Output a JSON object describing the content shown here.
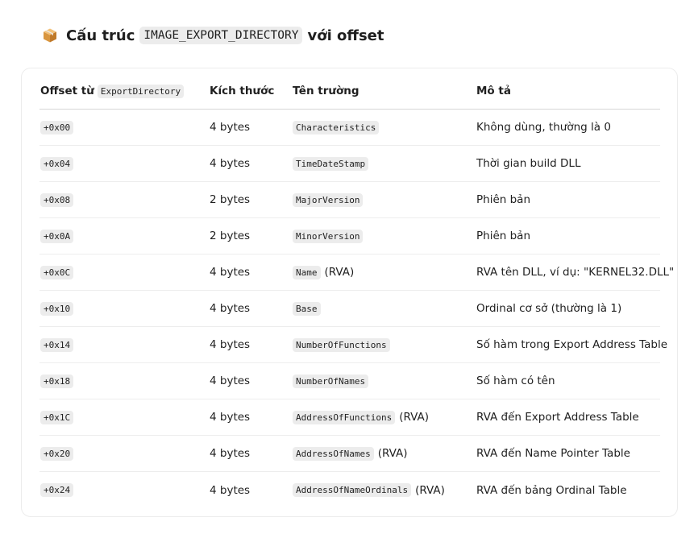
{
  "heading": {
    "prefix": "Cấu trúc",
    "code": "IMAGE_EXPORT_DIRECTORY",
    "suffix": "với offset"
  },
  "table": {
    "headers": {
      "offset_label": "Offset từ",
      "offset_code": "ExportDirectory",
      "size": "Kích thước",
      "field": "Tên trường",
      "description": "Mô tả"
    },
    "rows": [
      {
        "offset": "+0x00",
        "size": "4 bytes",
        "field": "Characteristics",
        "field_suffix": "",
        "description": "Không dùng, thường là 0"
      },
      {
        "offset": "+0x04",
        "size": "4 bytes",
        "field": "TimeDateStamp",
        "field_suffix": "",
        "description": "Thời gian build DLL"
      },
      {
        "offset": "+0x08",
        "size": "2 bytes",
        "field": "MajorVersion",
        "field_suffix": "",
        "description": "Phiên bản"
      },
      {
        "offset": "+0x0A",
        "size": "2 bytes",
        "field": "MinorVersion",
        "field_suffix": "",
        "description": "Phiên bản"
      },
      {
        "offset": "+0x0C",
        "size": "4 bytes",
        "field": "Name",
        "field_suffix": "(RVA)",
        "description": "RVA tên DLL, ví dụ: \"KERNEL32.DLL\""
      },
      {
        "offset": "+0x10",
        "size": "4 bytes",
        "field": "Base",
        "field_suffix": "",
        "description": "Ordinal cơ sở (thường là 1)"
      },
      {
        "offset": "+0x14",
        "size": "4 bytes",
        "field": "NumberOfFunctions",
        "field_suffix": "",
        "description": "Số hàm trong Export Address Table"
      },
      {
        "offset": "+0x18",
        "size": "4 bytes",
        "field": "NumberOfNames",
        "field_suffix": "",
        "description": "Số hàm có tên"
      },
      {
        "offset": "+0x1C",
        "size": "4 bytes",
        "field": "AddressOfFunctions",
        "field_suffix": "(RVA)",
        "description": "RVA đến Export Address Table"
      },
      {
        "offset": "+0x20",
        "size": "4 bytes",
        "field": "AddressOfNames",
        "field_suffix": "(RVA)",
        "description": "RVA đến Name Pointer Table"
      },
      {
        "offset": "+0x24",
        "size": "4 bytes",
        "field": "AddressOfNameOrdinals",
        "field_suffix": "(RVA)",
        "description": "RVA đến bảng Ordinal Table"
      }
    ]
  }
}
